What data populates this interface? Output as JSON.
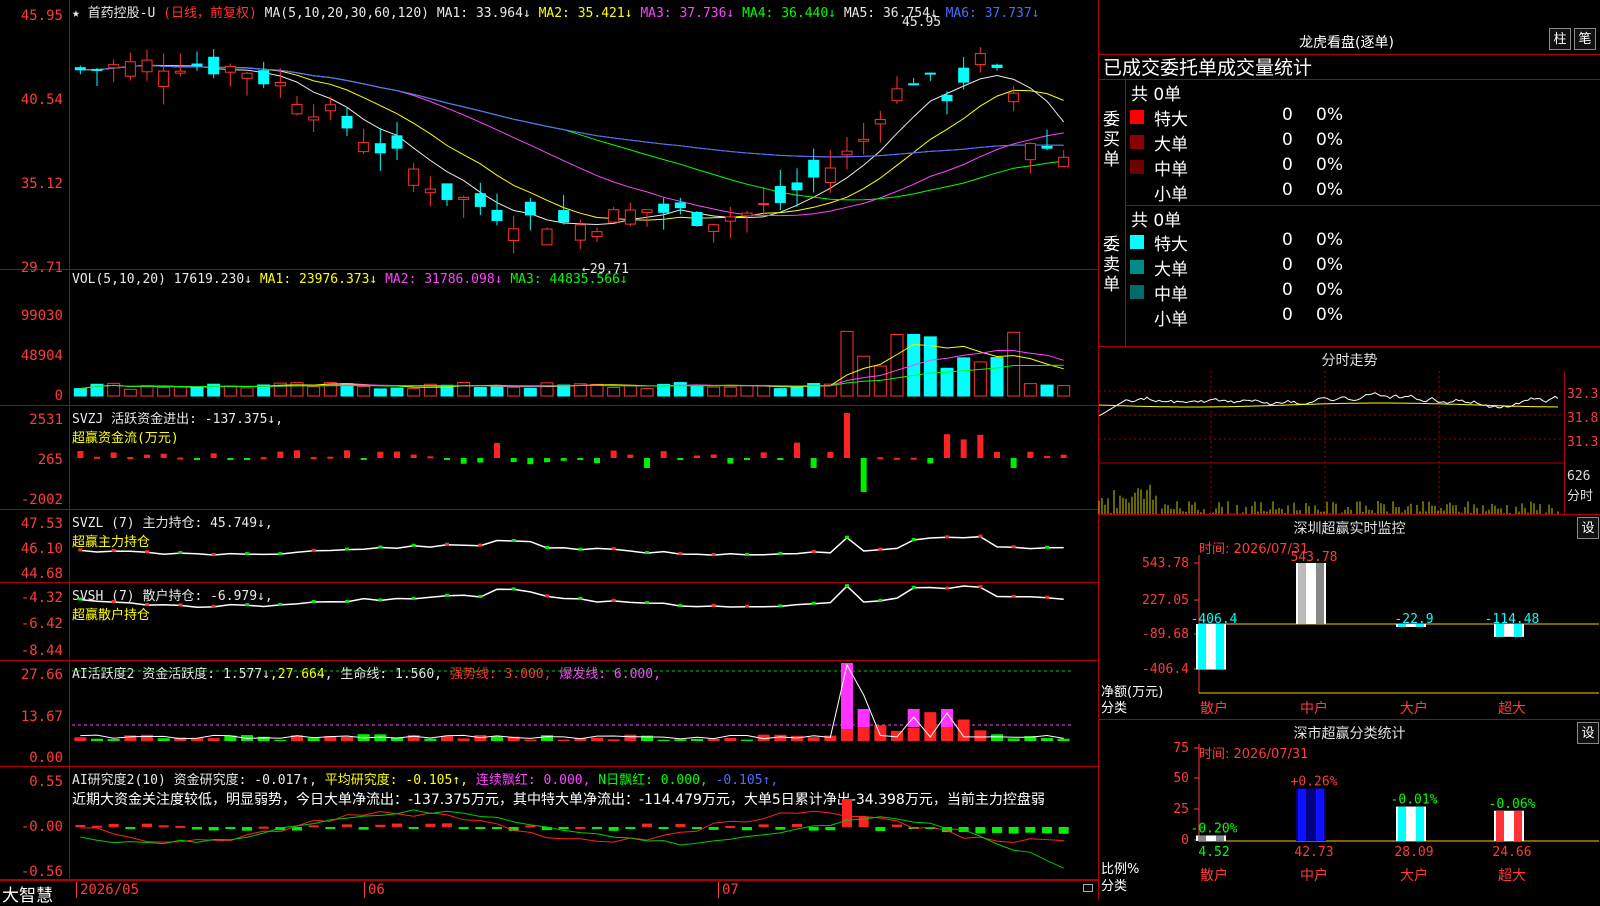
{
  "chart": {
    "title": "首药控股-U",
    "period": "(日线，前复权)",
    "ma_legend": "MA(5,10,20,30,60,120)",
    "ma": [
      {
        "label": "MA1: 33.964↓",
        "color": "#e8e8e8"
      },
      {
        "label": "MA2: 35.421↓",
        "color": "#ffff00"
      },
      {
        "label": "MA3: 37.736↓",
        "color": "#ff44ff"
      },
      {
        "label": "MA4: 36.440↓",
        "color": "#00ff00"
      },
      {
        "label": "MA5: 36.754↓",
        "color": "#e8e8e8"
      },
      {
        "label": "MA6: 37.737↓",
        "color": "#4f6bff"
      }
    ],
    "price_ticks": [
      "45.95",
      "40.54",
      "35.12",
      "29.71"
    ],
    "high_label": "45.95",
    "low_label": "←29.71",
    "x_labels": [
      "2026/05",
      "06",
      "07"
    ],
    "logo": "大智慧"
  },
  "vol": {
    "legend": "VOL(5,10,20)",
    "value": "17619.230↓",
    "ma1": "MA1: 23976.373↓",
    "ma2": "MA2: 31786.098↓",
    "ma3": "MA3: 44835.566↓",
    "ticks": [
      "99030",
      "48904",
      "0"
    ]
  },
  "svzj": {
    "legend": "SVZJ  活跃资金进出: -137.375↓,",
    "sub": "超赢资金流(万元)",
    "ticks": [
      "2531",
      "265",
      "-2002"
    ]
  },
  "svzl": {
    "legend": "SVZL (7) 主力持仓: 45.749↓,",
    "sub": "超赢主力持仓",
    "ticks": [
      "47.53",
      "46.10",
      "44.68"
    ]
  },
  "svsh": {
    "legend": "SVSH (7) 散户持仓: -6.979↓,",
    "sub": "超赢散户持仓",
    "ticks": [
      "-4.32",
      "-6.42",
      "-8.44"
    ]
  },
  "ai_active": {
    "legend": "AI活跃度2 资金活跃度: 1.577↓",
    "v2": "27.664",
    "life": "生命线: 1.560",
    "strong": "强势线: 3.000",
    "burst": "爆发线: 6.000",
    "ticks": [
      "27.66",
      "13.67",
      "0.00"
    ]
  },
  "ai_research": {
    "legend": "AI研究度2(10) 资金研究度: -0.017↑",
    "avg": "平均研究度: -0.105↑",
    "red": "连续飘红: 0.000",
    "nred": "N日飘红: 0.000",
    "v": "-0.105↑",
    "note": "近期大资金关注度较低，明显弱势，今日大单净流出：-137.375万元，其中特大单净流出：-114.479万元，大单5日累计净出-34.398万元，当前主力控盘弱",
    "ticks": [
      "0.55",
      "-0.00",
      "-0.56"
    ]
  },
  "side": {
    "lhb_title": "龙虎看盘(逐单)",
    "btn_zhu": "柱",
    "btn_bi": "笔",
    "tabs_header": "已成交委托单成交量统计",
    "buy_label": "委买单",
    "sell_label": "委卖单",
    "buy_total": "共 0单",
    "sell_total": "共 0单",
    "rows": [
      "特大",
      "大单",
      "中单",
      "小单"
    ],
    "row_values": [
      "0",
      "0",
      "0",
      "0"
    ],
    "row_pcts": [
      "0%",
      "0%",
      "0%",
      "0%"
    ],
    "intraday_title": "分时走势",
    "intraday_ticks": [
      "32.3",
      "31.8",
      "31.3"
    ],
    "intraday_vol": "626",
    "intraday_unit": "分时",
    "sz_monitor_title": "深圳超赢实时监控",
    "btn_set": "设",
    "time_label": "时间: 2026/07/31",
    "mon_ticks": [
      "543.78",
      "227.05",
      "-89.68",
      "-406.4"
    ],
    "mon_values": [
      "-406.4",
      "543.78",
      "-22.9",
      "-114.48"
    ],
    "net_label": "净额(万元)",
    "cat_label": "分类",
    "categories": [
      "散户",
      "中户",
      "大户",
      "超大"
    ],
    "sc_title": "深市超赢分类统计",
    "sc_time": "时间: 2026/07/31",
    "sc_ticks": [
      "75",
      "50",
      "25",
      "0"
    ],
    "sc_pct_changes": [
      "-0.20%",
      "+0.26%",
      "-0.01%",
      "-0.06%"
    ],
    "sc_values": [
      "4.52",
      "42.73",
      "28.09",
      "24.66"
    ],
    "ratio_label": "比例%"
  }
}
